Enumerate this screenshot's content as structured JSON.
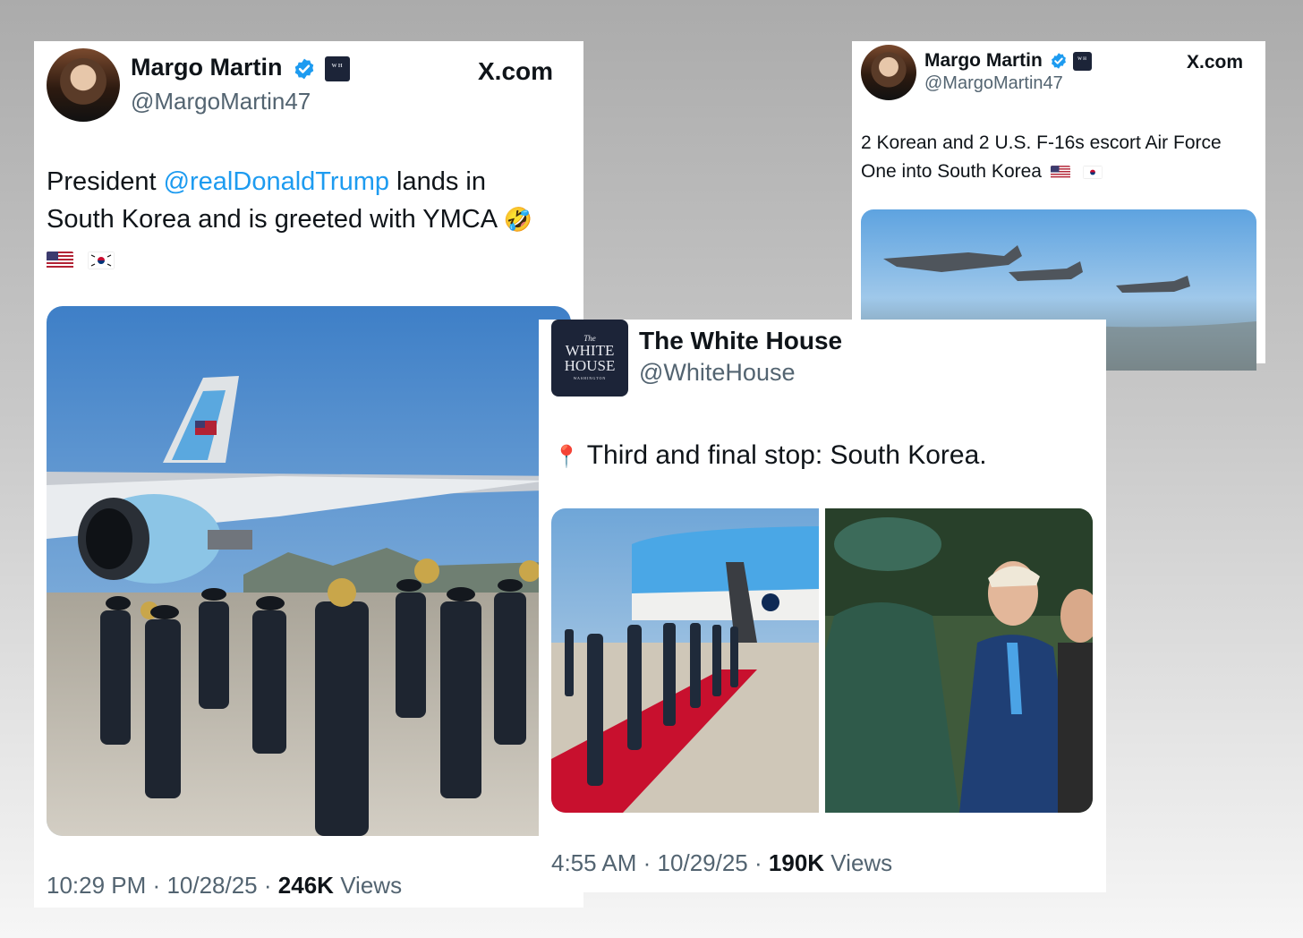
{
  "post1": {
    "author_name": "Margo Martin",
    "handle": "@MargoMartin47",
    "site": "X.com",
    "text_prefix": "President ",
    "mention": "@realDonaldTrump",
    "text_line1_suffix": " lands in",
    "text_line2": "South Korea and is greeted with YMCA",
    "emoji": "🤣",
    "flags": [
      "us-flag",
      "korea-flag"
    ],
    "time": "10:29 PM",
    "date": "10/28/25",
    "views_count": "246K",
    "views_label": "Views",
    "media": "band-at-air-force-one-photo"
  },
  "post2": {
    "author_name": "Margo Martin",
    "handle": "@MargoMartin47",
    "site": "X.com",
    "text_line1": "2 Korean and 2 U.S. F-16s escort Air Force",
    "text_line2": "One into South Korea",
    "flags": [
      "us-flag",
      "korea-flag"
    ],
    "media": "f16-escort-photo"
  },
  "post3": {
    "author_name": "The White House",
    "handle": "@WhiteHouse",
    "logo_small": "The",
    "logo_line1": "WHITE",
    "logo_line2": "HOUSE",
    "logo_sub": "WASHINGTON",
    "pin_icon": "📍",
    "text": "Third and final stop: South Korea.",
    "time": "4:55 AM",
    "date": "10/29/25",
    "views_count": "190K",
    "views_label": "Views",
    "media": [
      "honor-guard-red-carpet-photo",
      "trump-arrival-photo"
    ]
  },
  "separator": "·",
  "colors": {
    "mention_blue": "#1d9bf0",
    "verified_blue": "#1d9bf0",
    "wh_navy": "#1c2438",
    "secondary_text": "#536471"
  }
}
